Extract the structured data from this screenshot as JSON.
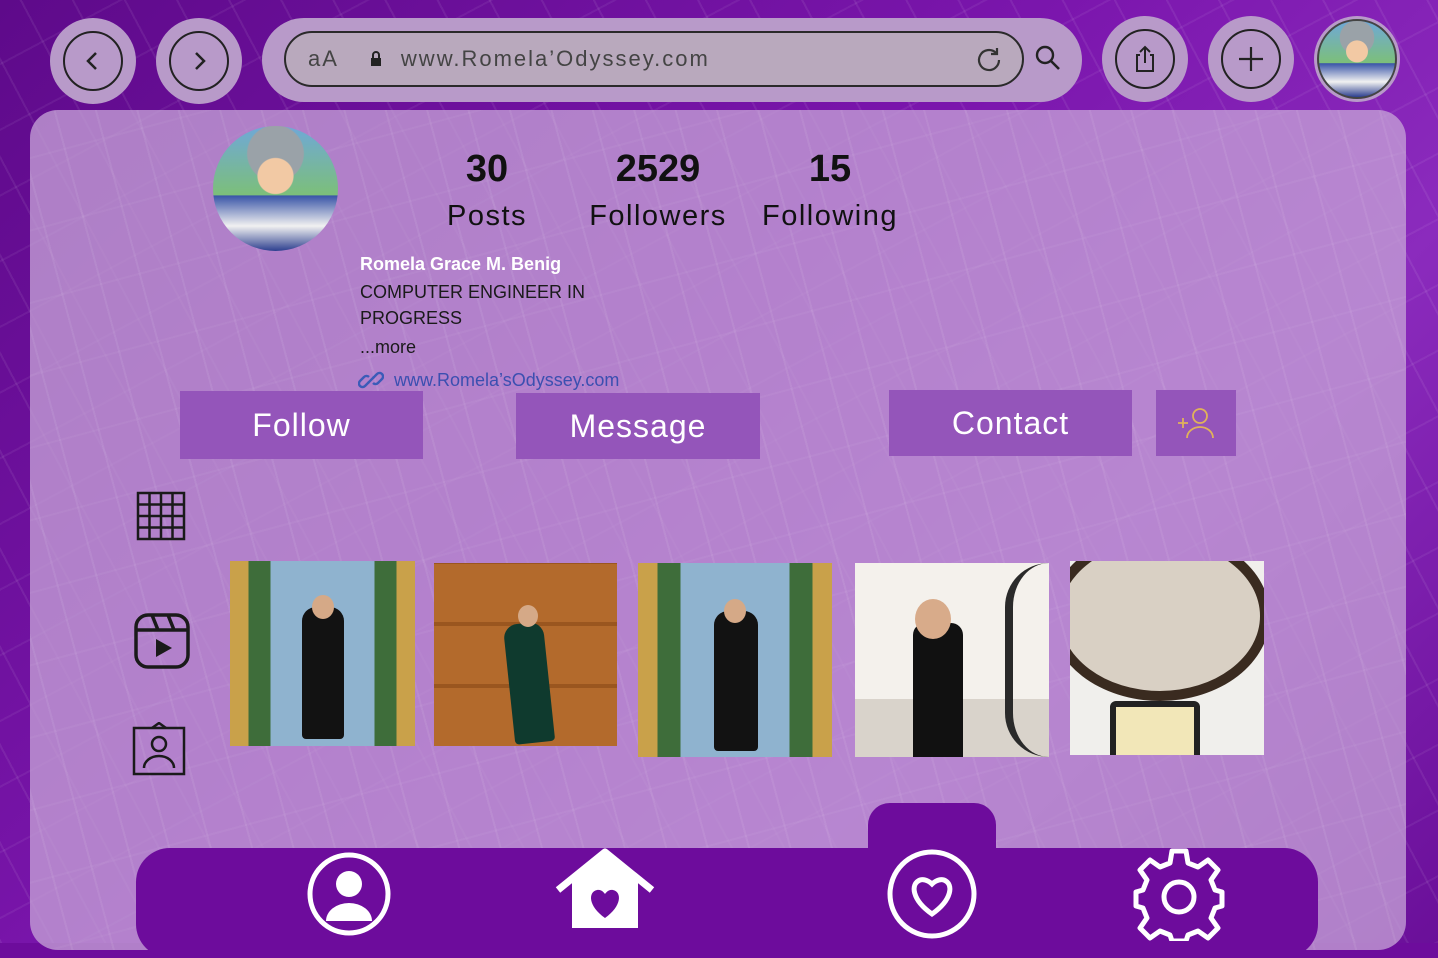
{
  "browser": {
    "text_size_label": "aA",
    "url": "www.Romela’Odyssey.com"
  },
  "profile": {
    "stats": [
      {
        "value": "30",
        "label": "Posts"
      },
      {
        "value": "2529",
        "label": "Followers"
      },
      {
        "value": "15",
        "label": "Following"
      }
    ],
    "name": "Romela Grace M. Benig",
    "bio_line1": "COMPUTER ENGINEER  IN",
    "bio_line2": "PROGRESS",
    "more": "...more",
    "website": "www.Romela’sOdyssey.com"
  },
  "actions": {
    "follow": "Follow",
    "message": "Message",
    "contact": "Contact"
  },
  "posts": [
    {
      "name": "post-1"
    },
    {
      "name": "post-2"
    },
    {
      "name": "post-3"
    },
    {
      "name": "post-4"
    },
    {
      "name": "post-5"
    }
  ],
  "colors": {
    "brand_purple": "#6d0c9c",
    "button_purple": "#9455ba",
    "panel_lilac": "#c4a0d6"
  },
  "icons": {
    "nav": [
      "back-icon",
      "forward-icon",
      "share-icon",
      "new-tab-icon"
    ],
    "side": [
      "grid-icon",
      "reels-icon",
      "tagged-icon"
    ],
    "bottom": [
      "profile-icon",
      "home-heart-icon",
      "heart-icon",
      "settings-icon"
    ]
  }
}
